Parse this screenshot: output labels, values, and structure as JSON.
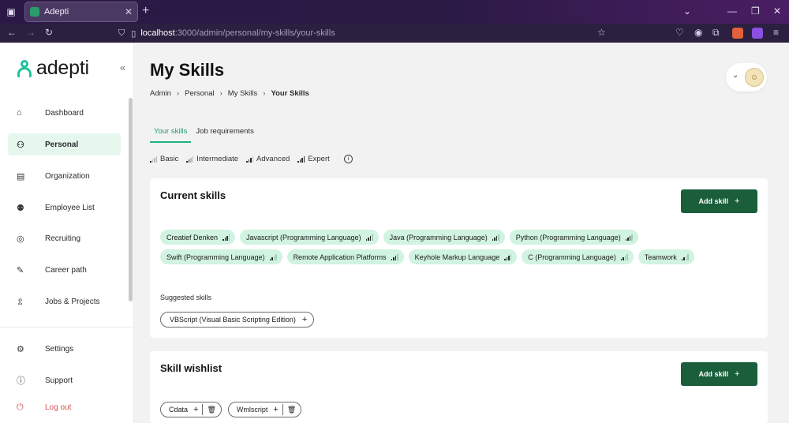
{
  "browser": {
    "tab_title": "Adepti",
    "url_host": "localhost",
    "url_path": ":3000/admin/personal/my-skills/your-skills"
  },
  "sidebar": {
    "logo": "adepti",
    "items": [
      {
        "label": "Dashboard",
        "icon": "home-icon"
      },
      {
        "label": "Personal",
        "icon": "user-icon"
      },
      {
        "label": "Organization",
        "icon": "briefcase-icon"
      },
      {
        "label": "Employee List",
        "icon": "users-icon"
      },
      {
        "label": "Recruiting",
        "icon": "eye-icon"
      },
      {
        "label": "Career path",
        "icon": "pencil-icon"
      },
      {
        "label": "Jobs & Projects",
        "icon": "stack-icon"
      }
    ],
    "bottom": [
      {
        "label": "Settings",
        "icon": "gear-icon"
      },
      {
        "label": "Support",
        "icon": "info-icon"
      },
      {
        "label": "Log out",
        "icon": "power-icon"
      }
    ]
  },
  "header": {
    "title": "My Skills",
    "breadcrumb": [
      "Admin",
      "Personal",
      "My Skills",
      "Your Skills"
    ]
  },
  "tabs": [
    "Your skills",
    "Job requirements"
  ],
  "legend": [
    "Basic",
    "Intermediate",
    "Advanced",
    "Expert"
  ],
  "current": {
    "title": "Current skills",
    "add_label": "Add skill",
    "skills": [
      {
        "name": "Creatief Denken",
        "level": 3
      },
      {
        "name": "Javascript (Programming Language)",
        "level": 3
      },
      {
        "name": "Java (Programming Language)",
        "level": 3
      },
      {
        "name": "Python (Programming Language)",
        "level": 3
      },
      {
        "name": "Swift (Programming Language)",
        "level": 2
      },
      {
        "name": "Remote Application Platforms",
        "level": 3
      },
      {
        "name": "Keyhole Markup Language",
        "level": 3
      },
      {
        "name": "C (Programming Language)",
        "level": 2
      },
      {
        "name": "Teamwork",
        "level": 2
      }
    ],
    "suggested_label": "Suggested skills",
    "suggested": [
      "VBScript (Visual Basic Scripting Edition)"
    ]
  },
  "wishlist": {
    "title": "Skill wishlist",
    "add_label": "Add skill",
    "items": [
      "Cdata",
      "Wmlscript"
    ]
  },
  "colors": {
    "accent": "#20b47e",
    "button": "#1a5e3c",
    "chip": "#d1f3e1",
    "logout": "#d9534f"
  }
}
